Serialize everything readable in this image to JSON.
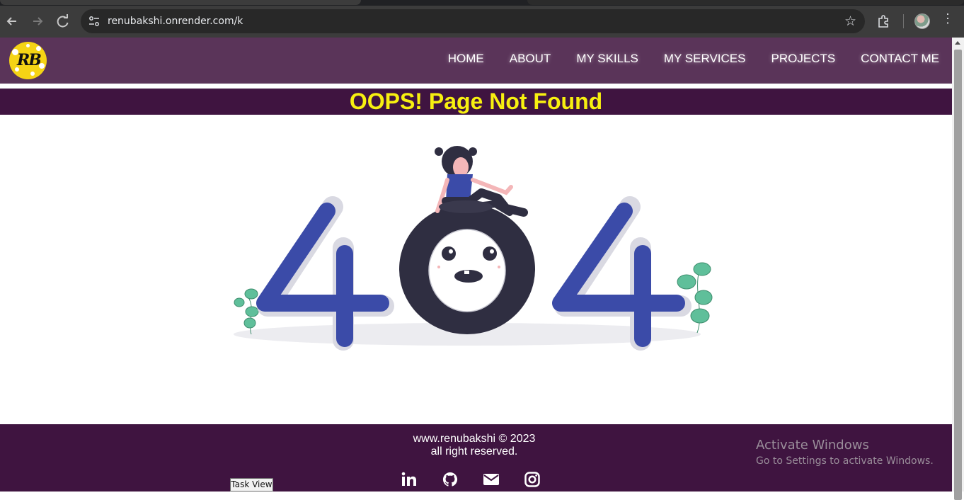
{
  "browser": {
    "url": "renubakshi.onrender.com/k",
    "icons": [
      "back-icon",
      "forward-icon",
      "reload-icon",
      "site-info-icon",
      "bookmark-star-icon",
      "extensions-icon",
      "profile-avatar",
      "menu-kebab-icon"
    ]
  },
  "site": {
    "logo_text": "RB",
    "nav": [
      "HOME",
      "ABOUT",
      "MY SKILLS",
      "MY SERVICES",
      "PROJECTS",
      "CONTACT ME"
    ]
  },
  "main": {
    "heading": "OOPS! Page Not Found",
    "illustration": "404 illustration with a woman sitting on the zero"
  },
  "footer": {
    "copyright_line1": "www.renubakshi © 2023",
    "copyright_line2": "all right reserved.",
    "social_icons": [
      "linkedin-icon",
      "github-icon",
      "email-icon",
      "instagram-icon"
    ]
  },
  "overlay": {
    "activate_title": "Activate Windows",
    "activate_subtitle": "Go to Settings to activate Windows.",
    "tooltip": "Task View"
  },
  "colors": {
    "header_bg": "#5a3459",
    "banner_bg": "#3f1440",
    "heading": "#f7f010",
    "digit_four": "#3b4ba8",
    "digit_zero": "#2f2e41",
    "leaf": "#5fbf9a"
  }
}
